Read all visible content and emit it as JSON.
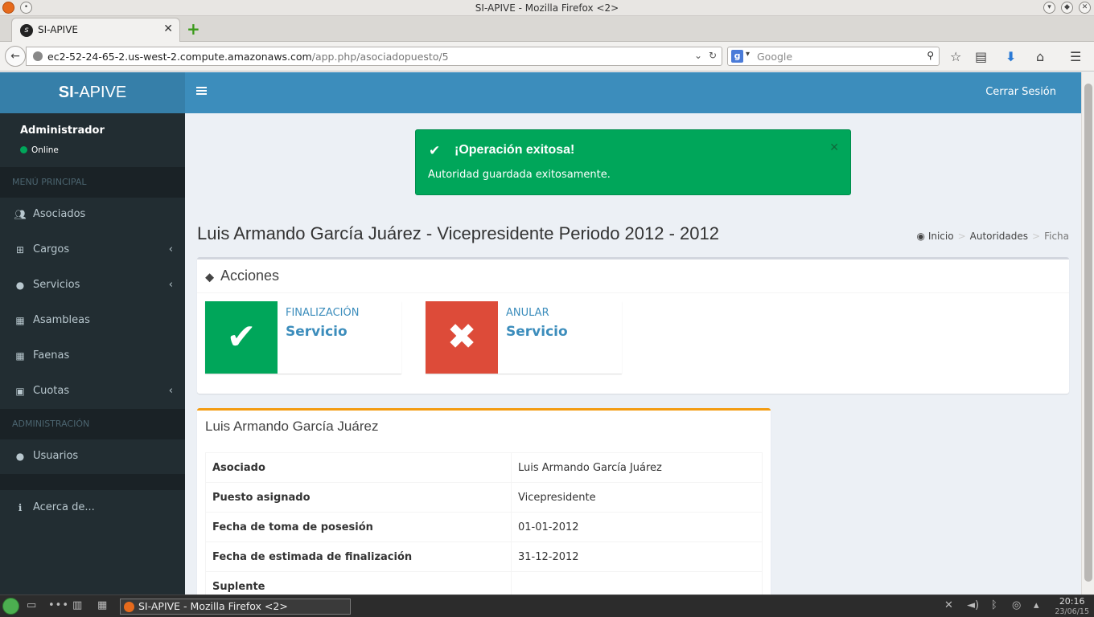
{
  "window": {
    "title": "SI-APIVE - Mozilla Firefox <2>"
  },
  "browser": {
    "tab_title": "SI-APIVE",
    "url_host": "ec2-52-24-65-2.us-west-2.compute.amazonaws.com",
    "url_path": "/app.php/asociadopuesto/5",
    "search_engine": "Google",
    "search_placeholder": "Google"
  },
  "app": {
    "logo_bold": "SI",
    "logo_rest": "-APIVE",
    "logout": "Cerrar Sesión",
    "accent": "#3c8dbc",
    "sidebar_bg": "#222d32"
  },
  "user": {
    "name": "Administrador",
    "status": "Online"
  },
  "sidebar": {
    "main_header": "MENÚ PRINCIPAL",
    "admin_header": "ADMINISTRACIÓN",
    "items": [
      {
        "label": "Asociados",
        "icon": "users-icon",
        "has_children": false
      },
      {
        "label": "Cargos",
        "icon": "sitemap-icon",
        "has_children": true
      },
      {
        "label": "Servicios",
        "icon": "tint-icon",
        "has_children": true
      },
      {
        "label": "Asambleas",
        "icon": "calendar-icon",
        "has_children": false
      },
      {
        "label": "Faenas",
        "icon": "calendar-icon",
        "has_children": false
      },
      {
        "label": "Cuotas",
        "icon": "money-icon",
        "has_children": true
      }
    ],
    "admin_items": [
      {
        "label": "Usuarios",
        "icon": "user-icon"
      }
    ],
    "about": {
      "label": "Acerca de...",
      "icon": "info-icon"
    }
  },
  "alert": {
    "title": "¡Operación exitosa!",
    "message": "Autoridad guardada exitosamente.",
    "color": "#00a65a"
  },
  "page": {
    "title": "Luis Armando García Juárez - Vicepresidente Periodo 2012 - 2012",
    "breadcrumb": [
      "Inicio",
      "Autoridades",
      "Ficha"
    ]
  },
  "actions": {
    "title": "Acciones",
    "boxes": [
      {
        "label": "FINALIZACIÓN",
        "value": "Servicio",
        "color": "#00a65a",
        "icon": "check-icon"
      },
      {
        "label": "ANULAR",
        "value": "Servicio",
        "color": "#dd4b39",
        "icon": "times-icon"
      }
    ]
  },
  "detail": {
    "title": "Luis Armando García Juárez",
    "rows": [
      {
        "key": "Asociado",
        "value": "Luis Armando García Juárez"
      },
      {
        "key": "Puesto asignado",
        "value": "Vicepresidente"
      },
      {
        "key": "Fecha de toma de posesión",
        "value": "01-01-2012"
      },
      {
        "key": "Fecha de estimada de finalización",
        "value": "31-12-2012"
      },
      {
        "key": "Suplente",
        "value": ""
      }
    ]
  },
  "taskbar": {
    "task": "SI-APIVE - Mozilla Firefox <2>",
    "time": "20:16",
    "date": "23/06/15"
  }
}
